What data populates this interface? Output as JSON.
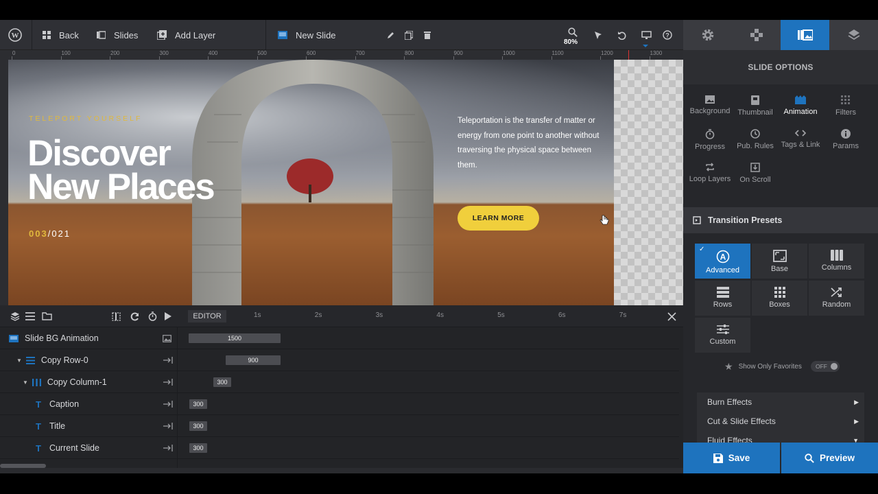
{
  "toolbar": {
    "back": "Back",
    "slides": "Slides",
    "add_layer": "Add Layer",
    "slide_name": "New Slide",
    "zoom": "80%"
  },
  "ruler": [
    "0",
    "100",
    "200",
    "300",
    "400",
    "500",
    "600",
    "700",
    "800",
    "900",
    "1000",
    "1100",
    "1200",
    "1300"
  ],
  "right_panel": {
    "header": "SLIDE OPTIONS",
    "options": [
      "Background",
      "Thumbnail",
      "Animation",
      "Filters",
      "Progress",
      "Pub. Rules",
      "Tags & Link",
      "Params",
      "Loop Layers",
      "On Scroll"
    ],
    "active_option": "Animation",
    "transition_presets": "Transition Presets",
    "presets": [
      "Advanced",
      "Base",
      "Columns",
      "Rows",
      "Boxes",
      "Random",
      "Custom"
    ],
    "active_preset": "Advanced",
    "favorites_label": "Show Only Favorites",
    "favorites_toggle": "OFF",
    "effects": [
      "Burn Effects",
      "Cut & Slide Effects",
      "Fluid Effects"
    ],
    "save": "Save",
    "preview": "Preview"
  },
  "slide": {
    "caption": "TELEPORT YOURSELF",
    "title_line1": "Discover",
    "title_line2": "New Places",
    "counter_current": "003",
    "counter_total": "/021",
    "description": "Teleportation is the transfer of matter or energy from one point to another without traversing the physical space between them.",
    "button": "LEARN MORE"
  },
  "timeline": {
    "editor": "EDITOR",
    "seconds": [
      "1s",
      "2s",
      "3s",
      "4s",
      "5s",
      "6s",
      "7s"
    ],
    "rows": [
      {
        "label": "Slide BG Animation",
        "value": "1500"
      },
      {
        "label": "Copy Row-0",
        "value": "900"
      },
      {
        "label": "Copy Column-1",
        "value": "300"
      },
      {
        "label": "Caption",
        "value": "300"
      },
      {
        "label": "Title",
        "value": "300"
      },
      {
        "label": "Current Slide",
        "value": "300"
      }
    ]
  },
  "colors": {
    "accent": "#1e73be",
    "brand_yellow": "#f0cf3c"
  }
}
